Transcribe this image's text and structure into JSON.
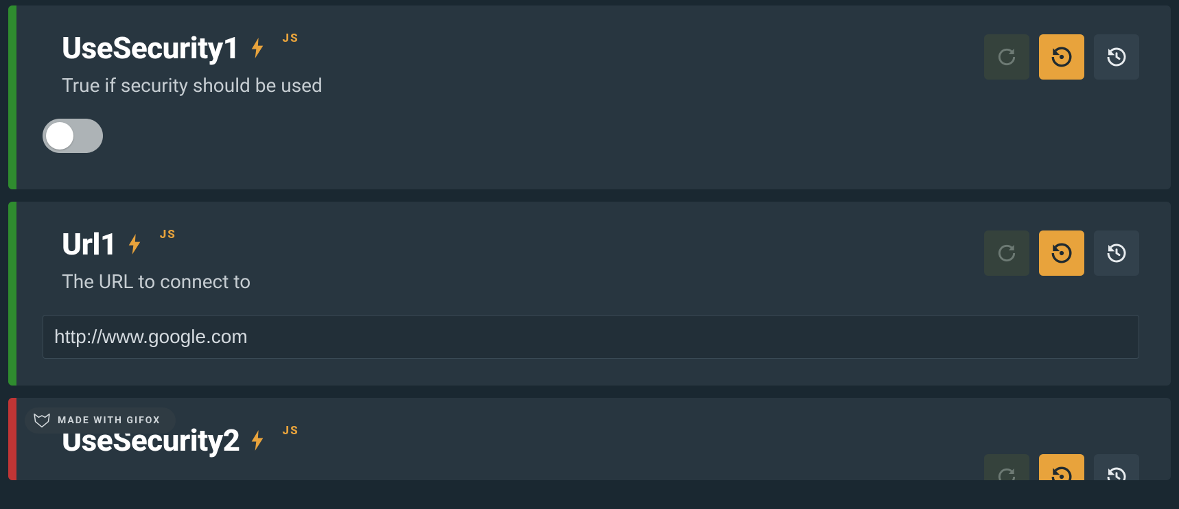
{
  "colors": {
    "accent": "#e8a33c",
    "stripe_green": "#2f8c2f",
    "stripe_red": "#c03535",
    "card_bg": "#283640",
    "page_bg": "#1a2831"
  },
  "badges": {
    "js": "JS"
  },
  "watermark": {
    "label": "MADE WITH GIFOX"
  },
  "cards": [
    {
      "stripe": "green",
      "title": "UseSecurity1",
      "description": "True if security should be used",
      "badge": "JS",
      "control": {
        "type": "toggle",
        "value": false
      },
      "actions": [
        "refresh",
        "restore",
        "history"
      ]
    },
    {
      "stripe": "green",
      "title": "Url1",
      "description": "The URL to connect to",
      "badge": "JS",
      "control": {
        "type": "text",
        "value": "http://www.google.com"
      },
      "actions": [
        "refresh",
        "restore",
        "history"
      ]
    },
    {
      "stripe": "red",
      "title": "UseSecurity2",
      "description": "",
      "badge": "JS",
      "control": {
        "type": "none"
      },
      "actions": [
        "refresh",
        "restore",
        "history"
      ]
    }
  ]
}
